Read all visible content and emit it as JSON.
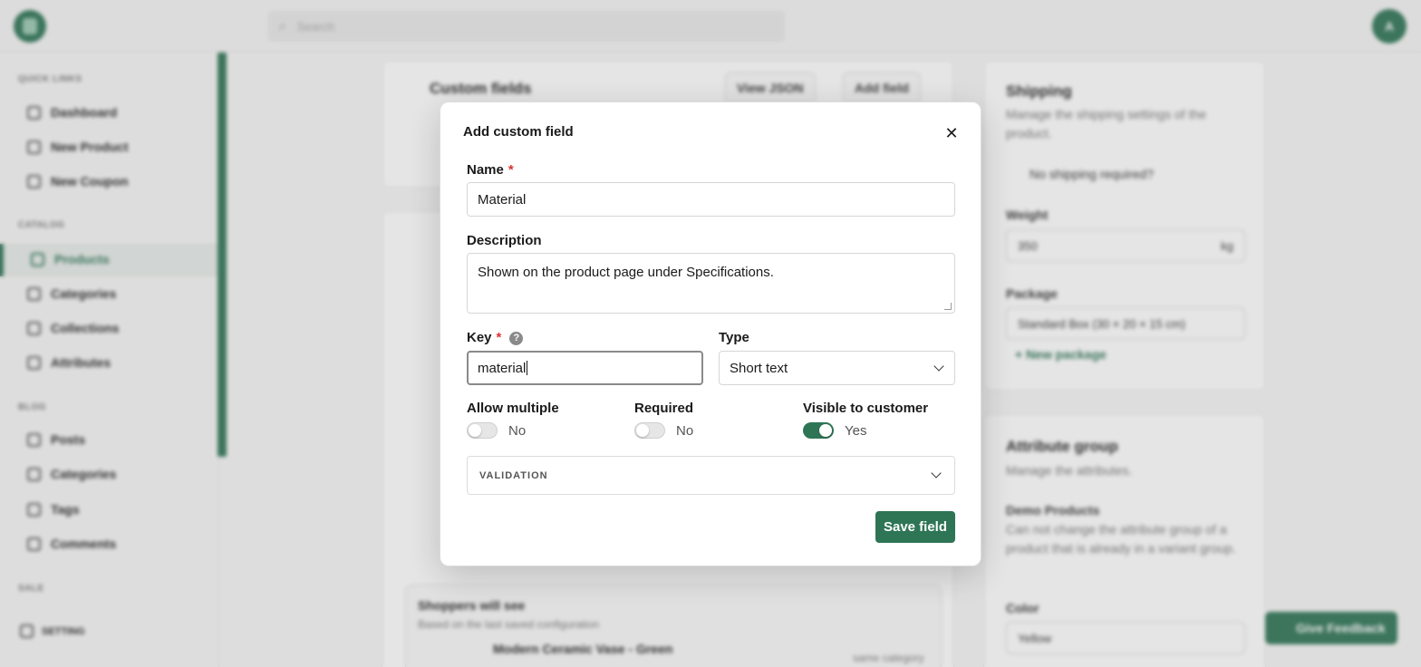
{
  "app": {
    "search_placeholder": "Search",
    "avatar_initial": "A",
    "feedback_label": "Give Feedback"
  },
  "sidebar": {
    "quick_links_header": "QUICK LINKS",
    "quick_links": [
      "Dashboard",
      "New Product",
      "New Coupon"
    ],
    "catalog_header": "CATALOG",
    "catalog": [
      "Products",
      "Categories",
      "Collections",
      "Attributes"
    ],
    "blog_header": "BLOG",
    "blog": [
      "Posts",
      "Categories",
      "Tags",
      "Comments"
    ],
    "sale_header": "SALE",
    "settings_label": "SETTING"
  },
  "background": {
    "custom_fields_title": "Custom fields",
    "view_json": "View JSON",
    "add_field": "Add field",
    "shipping_title": "Shipping",
    "shipping_desc": "Manage the shipping settings of the product.",
    "no_shipping": "No shipping required?",
    "weight_label": "Weight",
    "weight_value": "350",
    "weight_unit": "kg",
    "package_label": "Package",
    "package_value": "Standard Box (30 × 20 × 15 cm)",
    "new_package": "+ New package",
    "attr_group_title": "Attribute group",
    "attr_group_desc": "Manage the attributes.",
    "demo_products": "Demo Products",
    "demo_desc": "Can not change the attribute group of a product that is already in a variant group.",
    "color_label": "Color",
    "color_value": "Yellow",
    "shoppers_title": "Shoppers will see",
    "shoppers_sub": "Based on the last saved configuration",
    "product_name": "Modern Ceramic Vase - Green",
    "same_category": "same category"
  },
  "modal": {
    "title": "Add custom field",
    "name_label": "Name",
    "name_value": "Material",
    "required_mark": "*",
    "description_label": "Description",
    "description_value": "Shown on the product page under Specifications.",
    "key_label": "Key",
    "key_value": "material",
    "help_glyph": "?",
    "type_label": "Type",
    "type_value": "Short text",
    "allow_multiple_label": "Allow multiple",
    "allow_multiple_value": "No",
    "required_label": "Required",
    "required_value": "No",
    "visible_label": "Visible to customer",
    "visible_value": "Yes",
    "validation_label": "VALIDATION",
    "save_label": "Save field",
    "close_glyph": "✕"
  },
  "colors": {
    "accent": "#2e7556",
    "required": "#d33333"
  }
}
